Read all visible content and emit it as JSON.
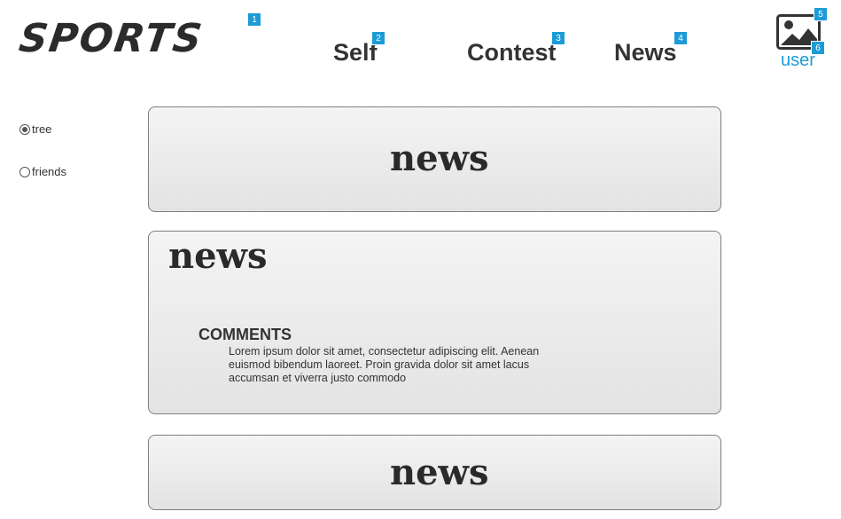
{
  "header": {
    "logo_text": "SPORTS",
    "badges": [
      "1",
      "2",
      "3",
      "4",
      "5",
      "6"
    ],
    "nav": [
      {
        "label": "Self"
      },
      {
        "label": "Contest"
      },
      {
        "label": "News"
      }
    ],
    "user": {
      "label": "user",
      "icon": "image-icon"
    }
  },
  "sidebar": {
    "options": [
      {
        "label": "tree",
        "checked": true
      },
      {
        "label": "friends",
        "checked": false
      }
    ]
  },
  "feed": {
    "cards": [
      {
        "title": "news"
      },
      {
        "title": "news",
        "comments_heading": "COMMENTS",
        "comments_text": "Lorem ipsum dolor sit amet, consectetur adipiscing elit. Aenean euismod bibendum laoreet. Proin gravida dolor sit amet lacus accumsan et viverra justo commodo"
      },
      {
        "title": "news"
      }
    ]
  },
  "colors": {
    "accent": "#1d9bd7",
    "text": "#333333",
    "card_border": "#7f7f7f"
  }
}
